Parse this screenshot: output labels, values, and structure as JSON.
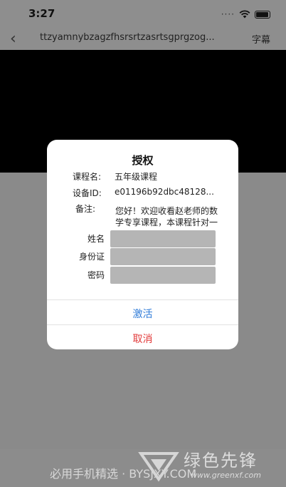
{
  "status_bar": {
    "time": "3:27",
    "signal_dots": "····"
  },
  "nav": {
    "back": "‹",
    "title": "ttzyamnybzagzfhsrsrtzasrtsgprgzog...",
    "subtitle_button": "字幕"
  },
  "dialog": {
    "title": "授权",
    "course_label": "课程名:",
    "course_value": "五年级课程",
    "device_label": "设备ID:",
    "device_value": "e01196b92dbc48128...",
    "remark_label": "备注:",
    "remark_value": "您好！欢迎收看赵老师的数学专享课程，本课程针对一年级学",
    "name_label": "姓名",
    "id_label": "身份证",
    "password_label": "密码",
    "activate_button": "激活",
    "cancel_button": "取消"
  },
  "watermark": {
    "left_text": "必用手机精选 · BYSJXY.COM",
    "brand": "绿色先锋",
    "url": "www.greenxf.com"
  },
  "colors": {
    "activate": "#2f7bd8",
    "cancel": "#e23b3b",
    "overlay": "#8a8a8a"
  }
}
